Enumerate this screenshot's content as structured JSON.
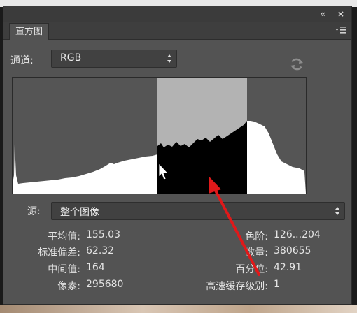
{
  "panel": {
    "tab_label": "直方图",
    "channel_label": "通道:",
    "channel_value": "RGB",
    "source_label": "源:",
    "source_value": "整个图像"
  },
  "stats_left": [
    {
      "label": "平均值:",
      "value": "155.03"
    },
    {
      "label": "标准偏差:",
      "value": "62.32"
    },
    {
      "label": "中间值:",
      "value": "164"
    },
    {
      "label": "像素:",
      "value": "295680"
    }
  ],
  "stats_right": [
    {
      "label": "色阶:",
      "value": "126...204"
    },
    {
      "label": "数量:",
      "value": "380655"
    },
    {
      "label": "百分位:",
      "value": "42.91"
    },
    {
      "label": "高速缓存级别:",
      "value": "1"
    }
  ],
  "histogram": {
    "selected_range": [
      126,
      204
    ],
    "colors": {
      "background": "#ffffff",
      "fill": "#555555",
      "selection_bg": "#b2b2b2",
      "selection_fill": "#000000",
      "annotation_arrow": "#e0191a"
    }
  },
  "icons": [
    "collapse-icon",
    "close-icon",
    "panel-menu-icon",
    "dropdown-arrow-icon",
    "refresh-icon",
    "cursor-icon",
    "arrow-annotation"
  ]
}
